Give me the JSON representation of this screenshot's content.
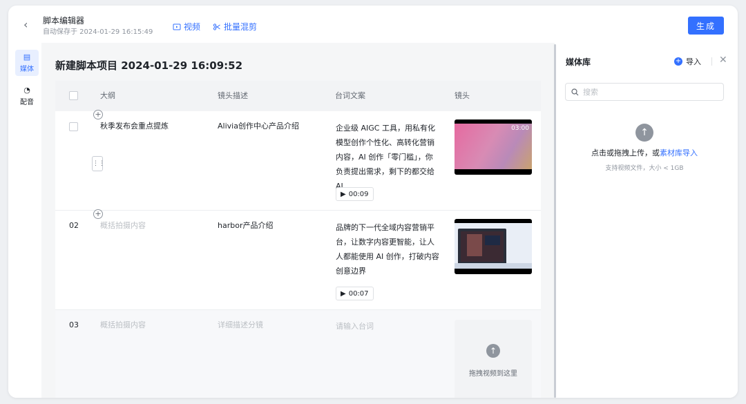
{
  "header": {
    "back_icon": "chevron-left-icon",
    "title": "脚本编辑器",
    "autosave": "自动保存于 2024-01-29 16:15:49",
    "video_label": "视频",
    "batch_label": "批量混剪",
    "generate_label": "生成",
    "accent": "#3370ff"
  },
  "rail": {
    "media_label": "媒体",
    "dubbing_label": "配音"
  },
  "project": {
    "title": "新建脚本项目 2024-01-29 16:09:52"
  },
  "table": {
    "headers": [
      "大纲",
      "镜头描述",
      "台词文案",
      "镜头"
    ],
    "rows": [
      {
        "outline": "秋季发布会重点提炼",
        "shot_desc": "Alivia创作中心产品介绍",
        "script": "企业级 AIGC 工具，用私有化模型创作个性化、高转化营销内容，AI 创作「零门槛」，你负责提出需求，剩下的都交给 AI",
        "duration": "00:09",
        "thumb_time": "03:00"
      },
      {
        "number": "02",
        "outline_placeholder": "概括拍摄内容",
        "shot_desc": "harbor产品介绍",
        "script": "品牌的下一代全域内容营销平台，让数字内容更智能，让人人都能使用 AI 创作，打破内容创意边界",
        "duration": "00:07"
      },
      {
        "number": "03",
        "outline_placeholder": "概括拍摄内容",
        "shot_desc_placeholder": "详细描述分镜",
        "script_placeholder": "请输入台词",
        "upload_hint": "拖拽视频到这里"
      }
    ]
  },
  "media": {
    "title": "媒体库",
    "import_label": "导入",
    "search_placeholder": "搜索",
    "upload_hint": "点击或拖拽上传，或",
    "upload_link": "素材库导入",
    "upload_sub": "支持视频文件，大小 < 1GB"
  }
}
